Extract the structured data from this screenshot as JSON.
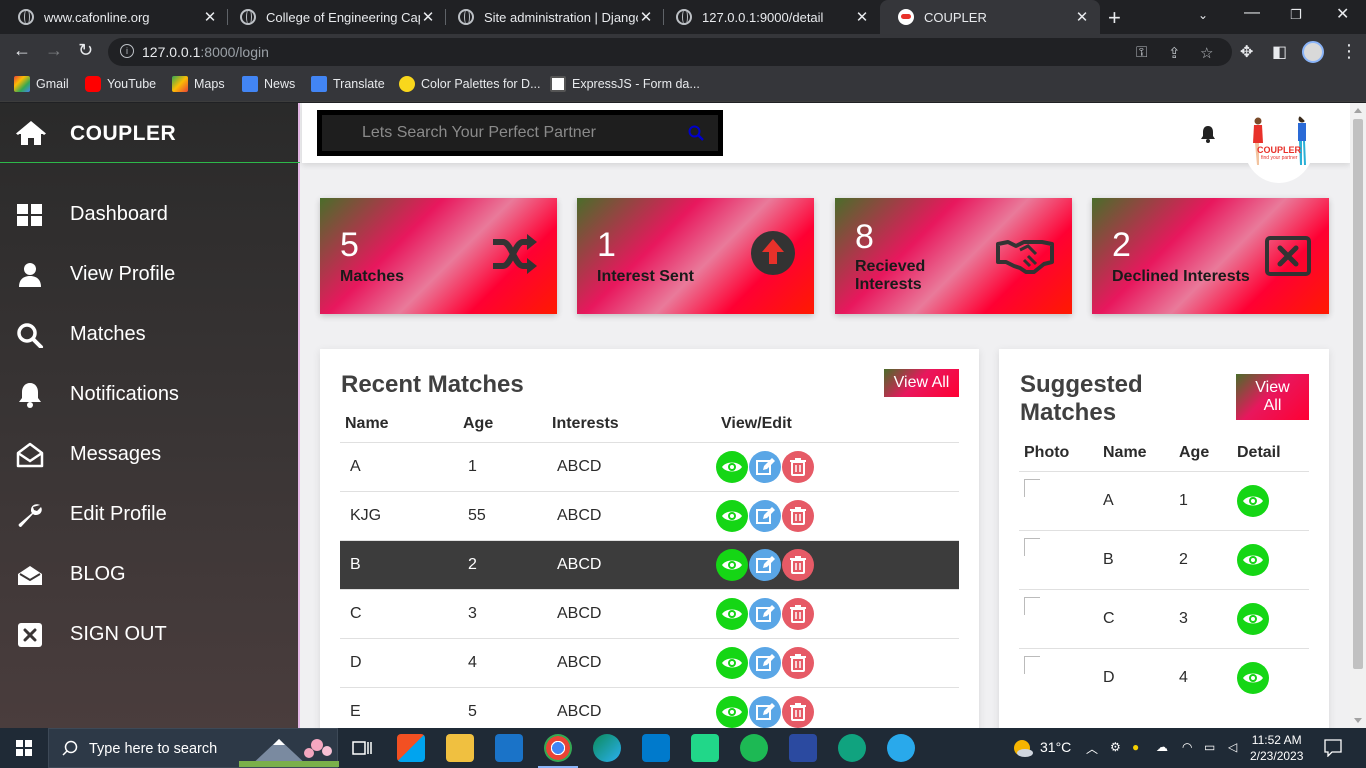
{
  "browser": {
    "tabs": [
      {
        "title": "www.cafonline.org"
      },
      {
        "title": "College of Engineering Captio"
      },
      {
        "title": "Site administration | Django s"
      },
      {
        "title": "127.0.0.1:9000/detail"
      },
      {
        "title": "COUPLER"
      }
    ],
    "url_host": "127.0.0.1",
    "url_rest": ":8000/login",
    "bookmarks": [
      {
        "label": "Gmail"
      },
      {
        "label": "YouTube"
      },
      {
        "label": "Maps"
      },
      {
        "label": "News"
      },
      {
        "label": "Translate"
      },
      {
        "label": "Color Palettes for D..."
      },
      {
        "label": "ExpressJS - Form da..."
      }
    ]
  },
  "sidebar": {
    "brand": "COUPLER",
    "items": [
      {
        "label": "Dashboard",
        "icon": "grid-icon"
      },
      {
        "label": "View Profile",
        "icon": "user-icon"
      },
      {
        "label": "Matches",
        "icon": "search-icon"
      },
      {
        "label": "Notifications",
        "icon": "bell-icon"
      },
      {
        "label": "Messages",
        "icon": "envelope-open-icon"
      },
      {
        "label": "Edit Profile",
        "icon": "wrench-icon"
      },
      {
        "label": "BLOG",
        "icon": "envelope-icon"
      },
      {
        "label": "SIGN OUT",
        "icon": "close-square-icon"
      }
    ]
  },
  "topbar": {
    "search_placeholder": "Lets Search Your Perfect Partner",
    "logo_text": "COUPLER",
    "logo_tagline": "find your partner"
  },
  "cards": [
    {
      "number": "5",
      "label": "Matches",
      "icon": "shuffle-icon"
    },
    {
      "number": "1",
      "label": "Interest Sent",
      "icon": "arrow-up-circle-icon"
    },
    {
      "number": "8",
      "label": "Recieved Interests",
      "icon": "handshake-icon"
    },
    {
      "number": "2",
      "label": "Declined Interests",
      "icon": "close-box-icon"
    }
  ],
  "recent": {
    "title": "Recent Matches",
    "view_all": "View All",
    "columns": [
      "Name",
      "Age",
      "Interests",
      "View/Edit"
    ],
    "rows": [
      {
        "name": "A",
        "age": "1",
        "interests": "ABCD"
      },
      {
        "name": "KJG",
        "age": "55",
        "interests": "ABCD"
      },
      {
        "name": "B",
        "age": "2",
        "interests": "ABCD"
      },
      {
        "name": "C",
        "age": "3",
        "interests": "ABCD"
      },
      {
        "name": "D",
        "age": "4",
        "interests": "ABCD"
      },
      {
        "name": "E",
        "age": "5",
        "interests": "ABCD"
      }
    ]
  },
  "suggested": {
    "title_line1": "Suggested",
    "title_line2": "Matches",
    "view_all_line1": "View",
    "view_all_line2": "All",
    "columns": [
      "Photo",
      "Name",
      "Age",
      "Detail"
    ],
    "rows": [
      {
        "name": "A",
        "age": "1"
      },
      {
        "name": "B",
        "age": "2"
      },
      {
        "name": "C",
        "age": "3"
      },
      {
        "name": "D",
        "age": "4"
      }
    ]
  },
  "taskbar": {
    "search_label": "Type here to search",
    "weather": "31°C",
    "time": "11:52 AM",
    "date": "2/23/2023"
  },
  "colors": {
    "accent_green": "#15d615",
    "edit_blue": "#5aa6e6",
    "delete_red": "#e65a66",
    "card_gradient_mid": "#e8175d"
  }
}
